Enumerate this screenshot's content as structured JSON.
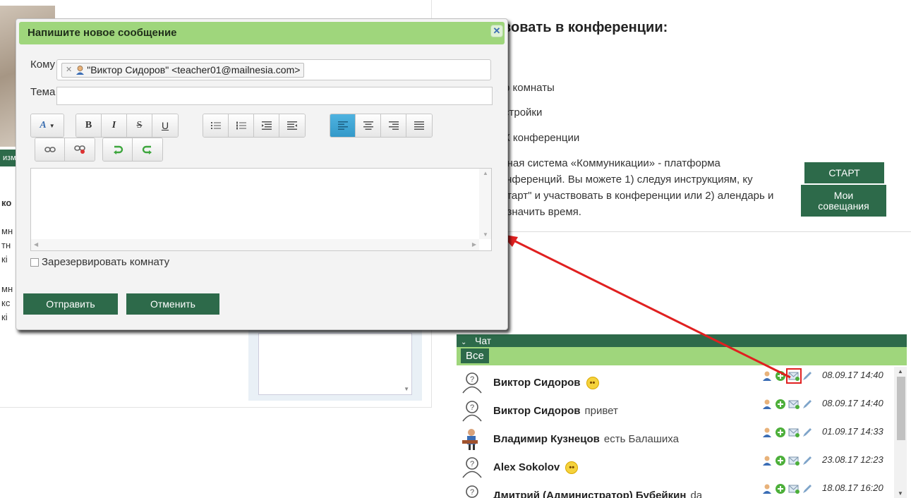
{
  "background": {
    "left_strip_text": "изм",
    "left_partial_lines": [
      "ко",
      "мн",
      "тн",
      "кі",
      "мн",
      "кс",
      "кі"
    ],
    "conference": {
      "title": "вовать в конференции:",
      "lines": [
        "р комнаты",
        "стройки",
        "К конференции"
      ],
      "description": "онная система «Коммуникации» - платформа конференций. Вы можете 1) следуя инструкциям, ку \"Старт\" и участвовать в конференции или 2) алендарь и назначить время.",
      "start_button": "СТАРТ",
      "meetings_button": "Мои совещания"
    }
  },
  "dialog": {
    "title": "Напишите новое сообщение",
    "close_icon": "close-icon",
    "to_label": "Кому",
    "recipient": "\"Виктор Сидоров\" <teacher01@mailnesia.com>",
    "subject_label": "Тема",
    "subject_value": "",
    "editor_value": "",
    "reserve_label": "Зарезервировать комнату",
    "send_button": "Отправить",
    "cancel_button": "Отменить",
    "toolbar": {
      "font_color": "A",
      "bold": "B",
      "italic": "I",
      "strike": "S",
      "underline": "U"
    }
  },
  "chat": {
    "header": "Чат",
    "tab_all": "Все",
    "messages": [
      {
        "name": "Виктор Сидоров",
        "text": "",
        "emoji": true,
        "time": "08.09.17 14:40",
        "avatar": "unknown-user-icon"
      },
      {
        "name": "Виктор Сидоров",
        "text": "привет",
        "emoji": false,
        "time": "08.09.17 14:40",
        "avatar": "unknown-user-icon"
      },
      {
        "name": "Владимир Кузнецов",
        "text": "есть Балашиха",
        "emoji": false,
        "time": "01.09.17 14:33",
        "avatar": "guitarist-avatar"
      },
      {
        "name": "Alex Sokolov",
        "text": "",
        "emoji": true,
        "time": "23.08.17 12:23",
        "avatar": "unknown-user-icon"
      },
      {
        "name": "Дмитрий (Администратор) Бубейкин",
        "text": "da",
        "emoji": false,
        "time": "18.08.17 16:20",
        "avatar": "unknown-user-icon"
      }
    ]
  },
  "colors": {
    "accent_green": "#9fd67c",
    "dark_green": "#2d6a4a",
    "highlight_red": "#e02020",
    "active_blue": "#3399c9"
  }
}
